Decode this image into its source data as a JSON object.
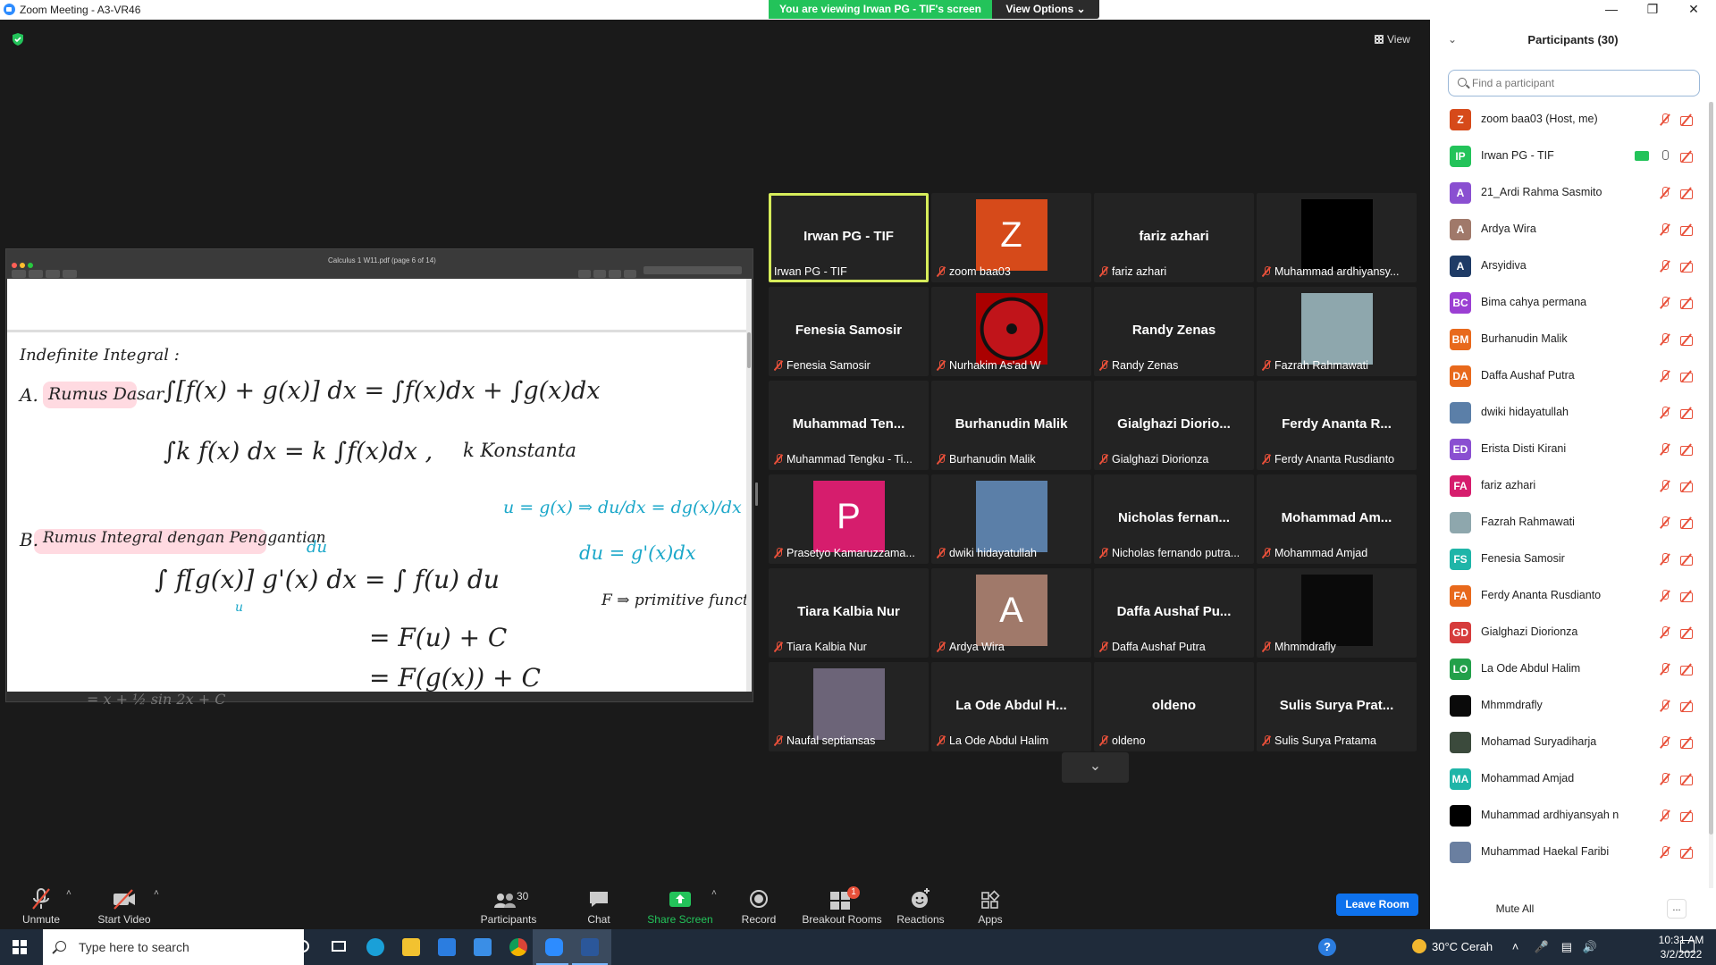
{
  "window": {
    "title": "Zoom Meeting - A3-VR46",
    "banner": "You are viewing Irwan PG - TIF's screen",
    "view_options": "View Options"
  },
  "stage": {
    "view_label": "View",
    "shared_doc_title": "Calculus 1 W11.pdf (page 6 of 14)",
    "notes": {
      "heading": "Indefinite Integral :",
      "a_label": "A.",
      "a_title": "Rumus Dasar",
      "a_line1": "∫[f(x) + g(x)] dx  =  ∫f(x)dx  +  ∫g(x)dx",
      "a_line2": "∫k f(x) dx  =  k ∫f(x)dx ,",
      "a_k": "k  Konstanta",
      "b_label": "B.",
      "b_title": "Rumus Integral dengan Penggantian",
      "b_line1": "∫ f[g(x)] g'(x) dx  =  ∫ f(u) du",
      "b_du": "du",
      "b_u": "u",
      "b_line2": "=  F(u) + C",
      "b_line3": "=  F(g(x)) + C",
      "side1": "u = g(x)  ⇒  du/dx = dg(x)/dx = g'(x)",
      "side2": "du = g'(x)dx",
      "side3": "F ⇒ primitive function",
      "under": "= x + ½ sin 2x + C"
    }
  },
  "gallery": {
    "tiles": [
      {
        "big": "Irwan PG - TIF",
        "label": "Irwan PG - TIF",
        "muted": false,
        "active": true
      },
      {
        "avatar": "Z",
        "avatar_color": "#d64a1a",
        "label": "zoom baa03",
        "muted": true
      },
      {
        "big": "fariz azhari",
        "label": "fariz azhari",
        "muted": true
      },
      {
        "photo": "#000000",
        "label": "Muhammad ardhiyansy...",
        "muted": true
      },
      {
        "big": "Fenesia Samosir",
        "label": "Fenesia Samosir",
        "muted": true
      },
      {
        "photo": "sharingan",
        "label": "Nurhakim As'ad W",
        "muted": true
      },
      {
        "big": "Randy Zenas",
        "label": "Randy Zenas",
        "muted": true
      },
      {
        "photo": "#8ea7ad",
        "label": "Fazrah Rahmawati",
        "muted": true
      },
      {
        "big": "Muhammad Ten...",
        "label": "Muhammad Tengku - Ti...",
        "muted": true
      },
      {
        "big": "Burhanudin Malik",
        "label": "Burhanudin Malik",
        "muted": true
      },
      {
        "big": "Gialghazi Diorio...",
        "label": "Gialghazi Diorionza",
        "muted": true
      },
      {
        "big": "Ferdy Ananta R...",
        "label": "Ferdy Ananta Rusdianto",
        "muted": true
      },
      {
        "avatar": "P",
        "avatar_color": "#d61d6d",
        "label": "Prasetyo Kamaruzzama...",
        "muted": true
      },
      {
        "photo": "#5b7fa8",
        "label": "dwiki hidayatullah",
        "muted": true
      },
      {
        "big": "Nicholas fernan...",
        "label": "Nicholas fernando putra...",
        "muted": true
      },
      {
        "big": "Mohammad Am...",
        "label": "Mohammad Amjad",
        "muted": true
      },
      {
        "big": "Tiara Kalbia Nur",
        "label": "Tiara Kalbia Nur",
        "muted": true
      },
      {
        "avatar": "A",
        "avatar_color": "#a0796a",
        "label": "Ardya Wira",
        "muted": true
      },
      {
        "big": "Daffa Aushaf Pu...",
        "label": "Daffa Aushaf Putra",
        "muted": true
      },
      {
        "photo": "#0a0a0a",
        "label": "Mhmmdrafly",
        "muted": true
      },
      {
        "photo": "#6c6478",
        "label": "Naufal septiansas",
        "muted": true
      },
      {
        "big": "La Ode Abdul H...",
        "label": "La Ode Abdul Halim",
        "muted": true
      },
      {
        "big": "oldeno",
        "label": "oldeno",
        "muted": true
      },
      {
        "big": "Sulis Surya Prat...",
        "label": "Sulis Surya Pratama",
        "muted": true
      }
    ]
  },
  "toolbar": {
    "unmute": "Unmute",
    "start_video": "Start Video",
    "participants": "Participants",
    "participants_count": "30",
    "chat": "Chat",
    "share_screen": "Share Screen",
    "record": "Record",
    "breakout_rooms": "Breakout Rooms",
    "breakout_badge": "1",
    "reactions": "Reactions",
    "apps": "Apps",
    "leave_room": "Leave Room"
  },
  "panel": {
    "title": "Participants (30)",
    "search_placeholder": "Find a participant",
    "mute_all": "Mute All",
    "more": "...",
    "participants": [
      {
        "initials": "Z",
        "color": "#d64a1a",
        "name": "zoom baa03 (Host, me)"
      },
      {
        "initials": "IP",
        "color": "#23c35a",
        "name": "Irwan PG - TIF",
        "sharing": true,
        "mic_on": true
      },
      {
        "initials": "A",
        "color": "#8a4fd1",
        "name": "21_Ardi Rahma Sasmito"
      },
      {
        "initials": "A",
        "color": "#a0796a",
        "name": "Ardya Wira"
      },
      {
        "initials": "A",
        "color": "#1f3b66",
        "name": "Arsyidiva"
      },
      {
        "initials": "BC",
        "color": "#9b3fd3",
        "name": "Bima cahya permana"
      },
      {
        "initials": "BM",
        "color": "#e8691c",
        "name": "Burhanudin Malik"
      },
      {
        "initials": "DA",
        "color": "#e8691c",
        "name": "Daffa Aushaf Putra"
      },
      {
        "photo": "#5b7fa8",
        "name": "dwiki hidayatullah"
      },
      {
        "initials": "ED",
        "color": "#8a4fd1",
        "name": "Erista Disti Kirani"
      },
      {
        "initials": "FA",
        "color": "#d61d6d",
        "name": "fariz azhari"
      },
      {
        "photo": "#8ea7ad",
        "name": "Fazrah Rahmawati"
      },
      {
        "initials": "FS",
        "color": "#1fb5a8",
        "name": "Fenesia Samosir"
      },
      {
        "initials": "FA",
        "color": "#e8691c",
        "name": "Ferdy Ananta Rusdianto"
      },
      {
        "initials": "GD",
        "color": "#d63c3c",
        "name": "Gialghazi Diorionza"
      },
      {
        "initials": "LO",
        "color": "#23a04a",
        "name": "La Ode Abdul Halim"
      },
      {
        "photo": "#0a0a0a",
        "name": "Mhmmdrafly"
      },
      {
        "photo": "#3b4a3c",
        "name": "Mohamad Suryadiharja"
      },
      {
        "initials": "MA",
        "color": "#1fb5a8",
        "name": "Mohammad Amjad"
      },
      {
        "photo": "#000000",
        "name": "Muhammad ardhiyansyah n"
      },
      {
        "photo": "#6a7fa0",
        "name": "Muhammad Haekal Faribi"
      }
    ]
  },
  "taskbar": {
    "search_placeholder": "Type here to search",
    "weather": "30°C  Cerah",
    "time": "10:31 AM",
    "date": "3/2/2022"
  }
}
